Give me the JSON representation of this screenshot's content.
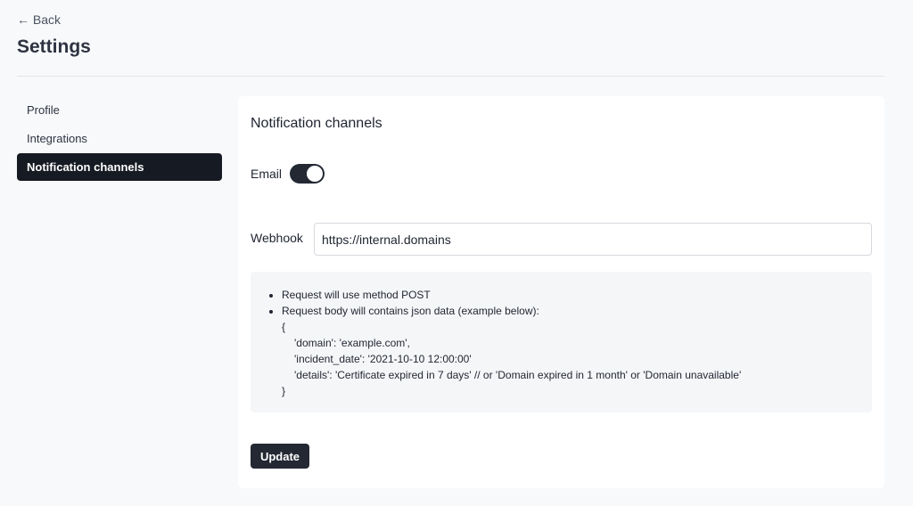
{
  "header": {
    "back": "← Back",
    "title": "Settings"
  },
  "nav": [
    {
      "label": "Profile"
    },
    {
      "label": "Integrations"
    },
    {
      "label": "Notification channels"
    }
  ],
  "card": {
    "title": "Notification channels",
    "email_label": "Email",
    "email_enabled": true,
    "webhook_label": "Webhook",
    "webhook_value": "https://internal.domains",
    "info": {
      "bullets": [
        "Request will use method POST",
        "Request body will contains json data (example below):"
      ],
      "code": [
        "{",
        "'domain': 'example.com',",
        "'incident_date': '2021-10-10 12:00:00'",
        "'details': 'Certificate expired in 7 days' // or 'Domain expired in 1 month' or 'Domain unavailable'",
        "}"
      ]
    },
    "update": "Update"
  }
}
